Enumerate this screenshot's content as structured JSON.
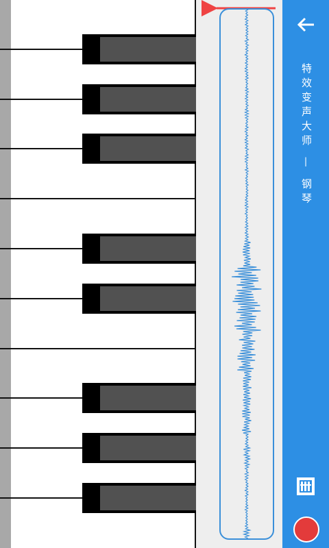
{
  "toolbar": {
    "title": "特效变声大师 — 钢琴",
    "back_icon": "arrow-left-icon",
    "keyboard_icon": "piano-keyboard-icon",
    "record_icon": "record-icon"
  },
  "colors": {
    "accent": "#2d8fe4",
    "waveform": "#3a8fd9",
    "playhead": "#ef4343",
    "record": "#e33b3b"
  },
  "piano": {
    "white_key_count": 11,
    "black_key_count": 8
  }
}
